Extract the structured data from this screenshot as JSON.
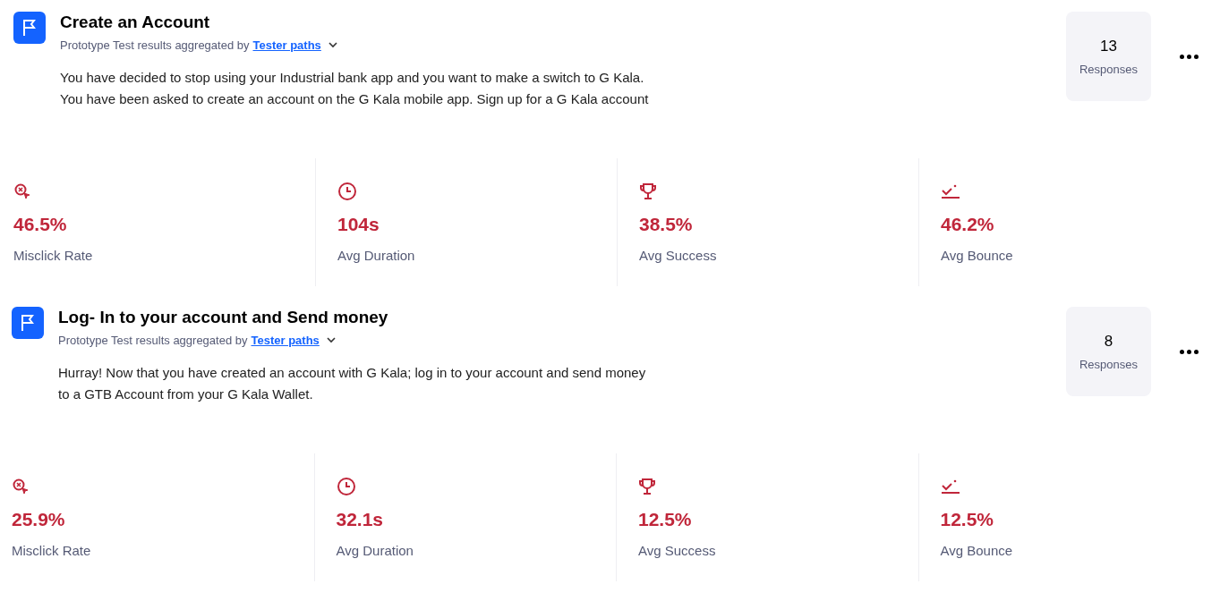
{
  "tasks": [
    {
      "title": "Create an Account",
      "subtitle": "Prototype Test results aggregated by",
      "link": "Tester paths",
      "description": [
        "You have decided to stop using your Industrial bank app and you want to make a switch to G Kala.",
        "You have been asked to create an account on the G Kala mobile app. Sign up for a G Kala account"
      ],
      "responses_count": "13",
      "responses_label": "Responses",
      "stats": [
        {
          "kind": "misclick",
          "value": "46.5%",
          "label": "Misclick Rate"
        },
        {
          "kind": "duration",
          "value": "104s",
          "label": "Avg Duration"
        },
        {
          "kind": "success",
          "value": "38.5%",
          "label": "Avg Success"
        },
        {
          "kind": "bounce",
          "value": "46.2%",
          "label": "Avg Bounce"
        }
      ]
    },
    {
      "title": "Log- In to your account and Send money",
      "subtitle": "Prototype Test results aggregated by",
      "link": "Tester paths",
      "description": [
        "Hurray! Now that you have created an account with G Kala; log in to your account and send money",
        "to a GTB Account from your G Kala Wallet."
      ],
      "responses_count": "8",
      "responses_label": "Responses",
      "stats": [
        {
          "kind": "misclick",
          "value": "25.9%",
          "label": "Misclick Rate"
        },
        {
          "kind": "duration",
          "value": "32.1s",
          "label": "Avg Duration"
        },
        {
          "kind": "success",
          "value": "12.5%",
          "label": "Avg Success"
        },
        {
          "kind": "bounce",
          "value": "12.5%",
          "label": "Avg Bounce"
        }
      ]
    }
  ]
}
